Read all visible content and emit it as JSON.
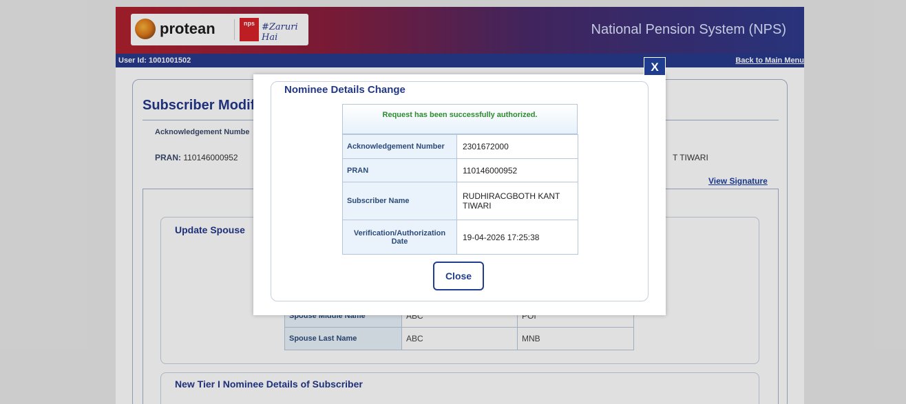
{
  "header": {
    "logo_text": "protean",
    "nps_badge": "nps",
    "tagline": "#Zaruri Hai",
    "title": "National Pension System (NPS)"
  },
  "userbar": {
    "user_id": "User Id: 1001001502",
    "back_link": "Back to Main Menu"
  },
  "main": {
    "heading": "Subscriber Modif",
    "ack_label": "Acknowledgement Numbe",
    "pran_label": "PRAN:",
    "pran_value": "110146000952",
    "name_tail": "T TIWARI",
    "view_signature": "View Signature",
    "spouse_section_title": "Update Spouse",
    "spouse_rows": [
      {
        "label": "Spouse Middle Name",
        "old": "ABC",
        "new": "POI"
      },
      {
        "label": "Spouse Last Name",
        "old": "ABC",
        "new": "MNB"
      }
    ],
    "nominee_section_title": "New Tier I Nominee Details of Subscriber"
  },
  "modal": {
    "close_x": "X",
    "title": "Nominee Details Change",
    "message": "Request has been successfully authorized.",
    "rows": [
      {
        "label": "Acknowledgement Number",
        "value": "2301672000"
      },
      {
        "label": "PRAN",
        "value": "110146000952"
      },
      {
        "label": "Subscriber Name",
        "value": "RUDHIRACGBOTH KANT TIWARI"
      },
      {
        "label": "Verification/Authorization Date",
        "value": "19-04-2026 17:25:38"
      }
    ],
    "close_button": "Close"
  },
  "colors": {
    "primary_blue": "#1f3c8f",
    "heading_blue": "#22378a",
    "success_green": "#2f8a2f",
    "brand_red": "#b0212e"
  }
}
